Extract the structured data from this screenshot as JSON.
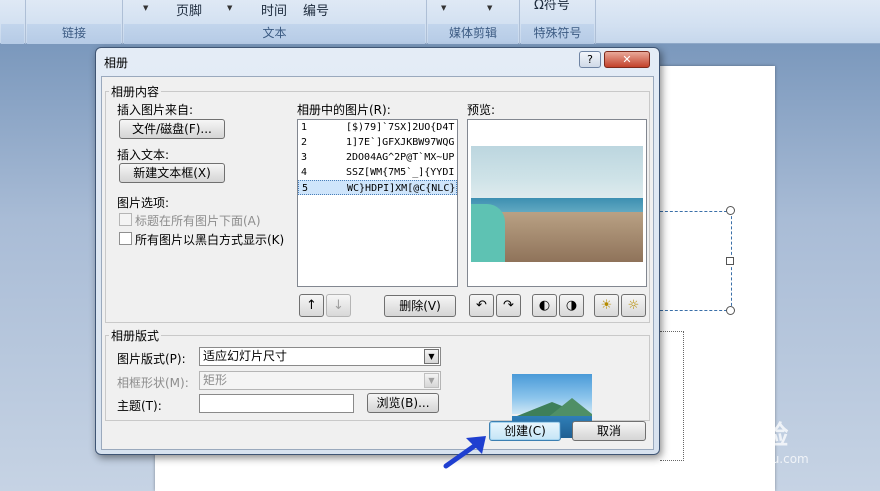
{
  "ribbon": {
    "items": [
      "页脚",
      "时间",
      "编号",
      "媒体剪辑"
    ],
    "groups": [
      "链接",
      "文本",
      "媒体剪辑",
      "特殊符号"
    ],
    "partial_top": "Ω符号"
  },
  "dialog": {
    "title": "相册",
    "help": "?",
    "close": "✕",
    "content_group": "相册内容",
    "insert_from": "插入图片来自:",
    "file_disk_button": "文件/磁盘(F)...",
    "insert_text": "插入文本:",
    "new_textbox_button": "新建文本框(X)",
    "picture_options": "图片选项:",
    "caption_below": "标题在所有图片下面(A)",
    "black_white": "所有图片以黑白方式显示(K)",
    "pictures_label": "相册中的图片(R):",
    "pictures": [
      {
        "n": "1",
        "name": "[$)79]`7SX]2UO{D4T"
      },
      {
        "n": "2",
        "name": "1]7E`]GFXJKBW97WQG"
      },
      {
        "n": "3",
        "name": "2DO04AG^2P@T`MX~UP"
      },
      {
        "n": "4",
        "name": "SSZ[WM{7M5`_]{YYDI"
      },
      {
        "n": "5",
        "name": "WC}HDPI]XM[@C{NLC}"
      }
    ],
    "selected_index": 4,
    "preview_label": "预览:",
    "remove_button": "删除(V)",
    "layout_group": "相册版式",
    "picture_layout_label": "图片版式(P):",
    "picture_layout_value": "适应幻灯片尺寸",
    "frame_shape_label": "相框形状(M):",
    "frame_shape_value": "矩形",
    "theme_label": "主题(T):",
    "theme_value": "",
    "browse_button": "浏览(B)...",
    "create_button": "创建(C)",
    "cancel_button": "取消"
  },
  "watermark": {
    "main": "Bai经验",
    "sub": "jingyan.baidu.com"
  }
}
